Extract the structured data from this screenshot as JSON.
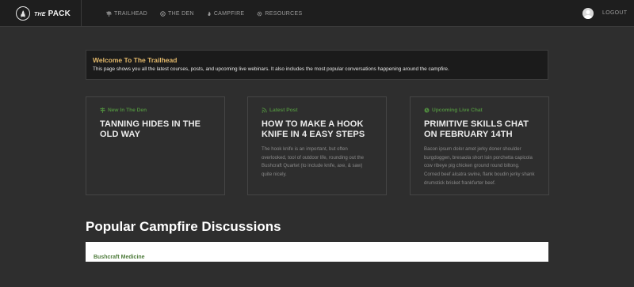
{
  "brand": {
    "lead": "THE",
    "name": "PACK"
  },
  "nav": {
    "items": [
      {
        "label": "Trailhead",
        "icon": "signpost-icon"
      },
      {
        "label": "The Den",
        "icon": "paw-icon"
      },
      {
        "label": "Campfire",
        "icon": "flame-icon"
      },
      {
        "label": "Resources",
        "icon": "gear-icon"
      }
    ],
    "logout": "LOGOUT"
  },
  "welcome": {
    "title": "Welcome To The Trailhead",
    "text": "This page shows you all the latest courses, posts, and upcoming live webinars. It also includes the most popular conversations happening around the campfire."
  },
  "cards": [
    {
      "kicker": "New In The Den",
      "kicker_icon": "signpost-icon",
      "title": "Tanning Hides In The Old Way",
      "body": ""
    },
    {
      "kicker": "Latest Post",
      "kicker_icon": "feed-icon",
      "title": "How To Make A Hook Knife In 4 Easy Steps",
      "body": "The hook knife is an important, but often overlooked, tool of outdoor life, rounding out the Bushcraft Quartet (to include knife, axe, & saw) quite nicely."
    },
    {
      "kicker": "Upcoming Live Chat",
      "kicker_icon": "clock-icon",
      "title": "Primitive Skills Chat On February 14th",
      "body": "Bacon ipsum dolor amet jerky doner shoulder burgdoggen, bresaola short loin porchetta capicola cow ribeye pig chicken ground round biltong. Corned beef alcatra swine, flank boudin jerky shank drumstick brisket frankfurter beef."
    }
  ],
  "popular": {
    "heading": "Popular Campfire Discussions",
    "items": [
      {
        "label": "Bushcraft Medicine"
      }
    ]
  },
  "colors": {
    "accent_green": "#4f8a3e",
    "welcome_gold": "#e2b86a",
    "page_bg": "#2e2e2e",
    "nav_bg": "#1e1e1e"
  }
}
